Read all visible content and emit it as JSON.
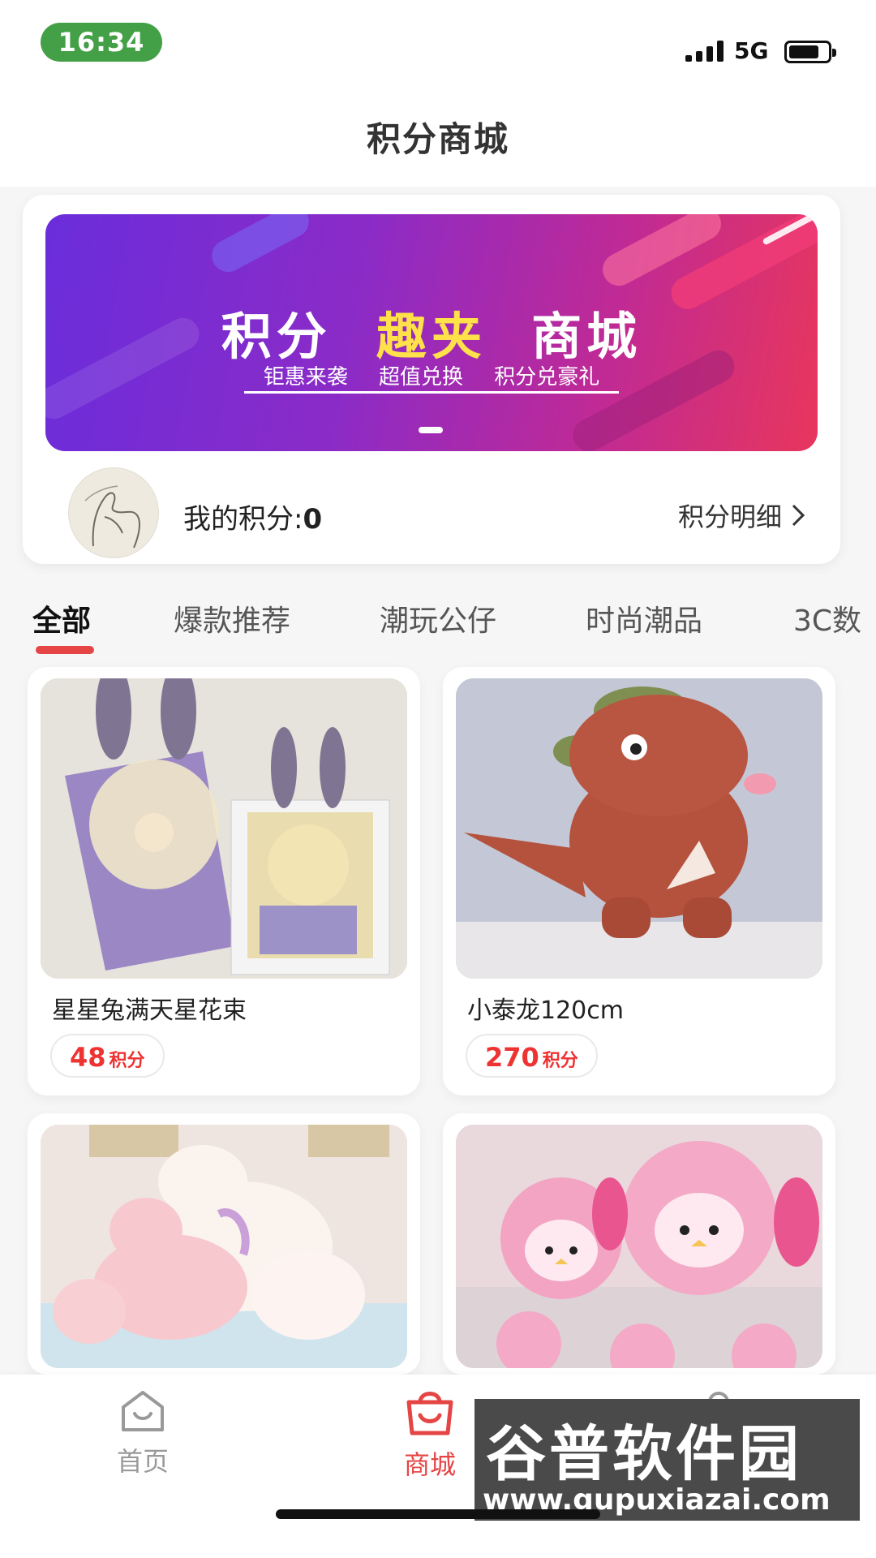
{
  "status_bar": {
    "time": "16:34",
    "network": "5G"
  },
  "header": {
    "title": "积分商城"
  },
  "banner": {
    "title_part1": "积分",
    "title_highlight": "趣夹",
    "title_part3": "商城",
    "subtitle": "钜惠来袭 超值兑换 积分兑豪礼"
  },
  "points": {
    "label": "我的积分:",
    "value": "0",
    "detail_link": "积分明细"
  },
  "tabs": [
    {
      "label": "全部"
    },
    {
      "label": "爆款推荐"
    },
    {
      "label": "潮玩公仔"
    },
    {
      "label": "时尚潮品"
    },
    {
      "label": "3C数"
    }
  ],
  "products": [
    {
      "name": "星星兔满天星花束",
      "points": "48",
      "unit": "积分"
    },
    {
      "name": "小泰龙120cm",
      "points": "270",
      "unit": "积分"
    },
    {
      "name": "",
      "points": "",
      "unit": ""
    },
    {
      "name": "",
      "points": "",
      "unit": ""
    }
  ],
  "bottom_nav": [
    {
      "label": "首页",
      "icon": "home-icon"
    },
    {
      "label": "商城",
      "icon": "shopping-bag-icon"
    },
    {
      "label": "",
      "icon": "user-icon"
    }
  ],
  "watermark": {
    "title": "谷普软件园",
    "url": "www.gupuxiazai.com"
  },
  "colors": {
    "accent": "#e64545",
    "banner_start": "#6a2ddb",
    "banner_end": "#e8365c",
    "status_green": "#43a047"
  }
}
